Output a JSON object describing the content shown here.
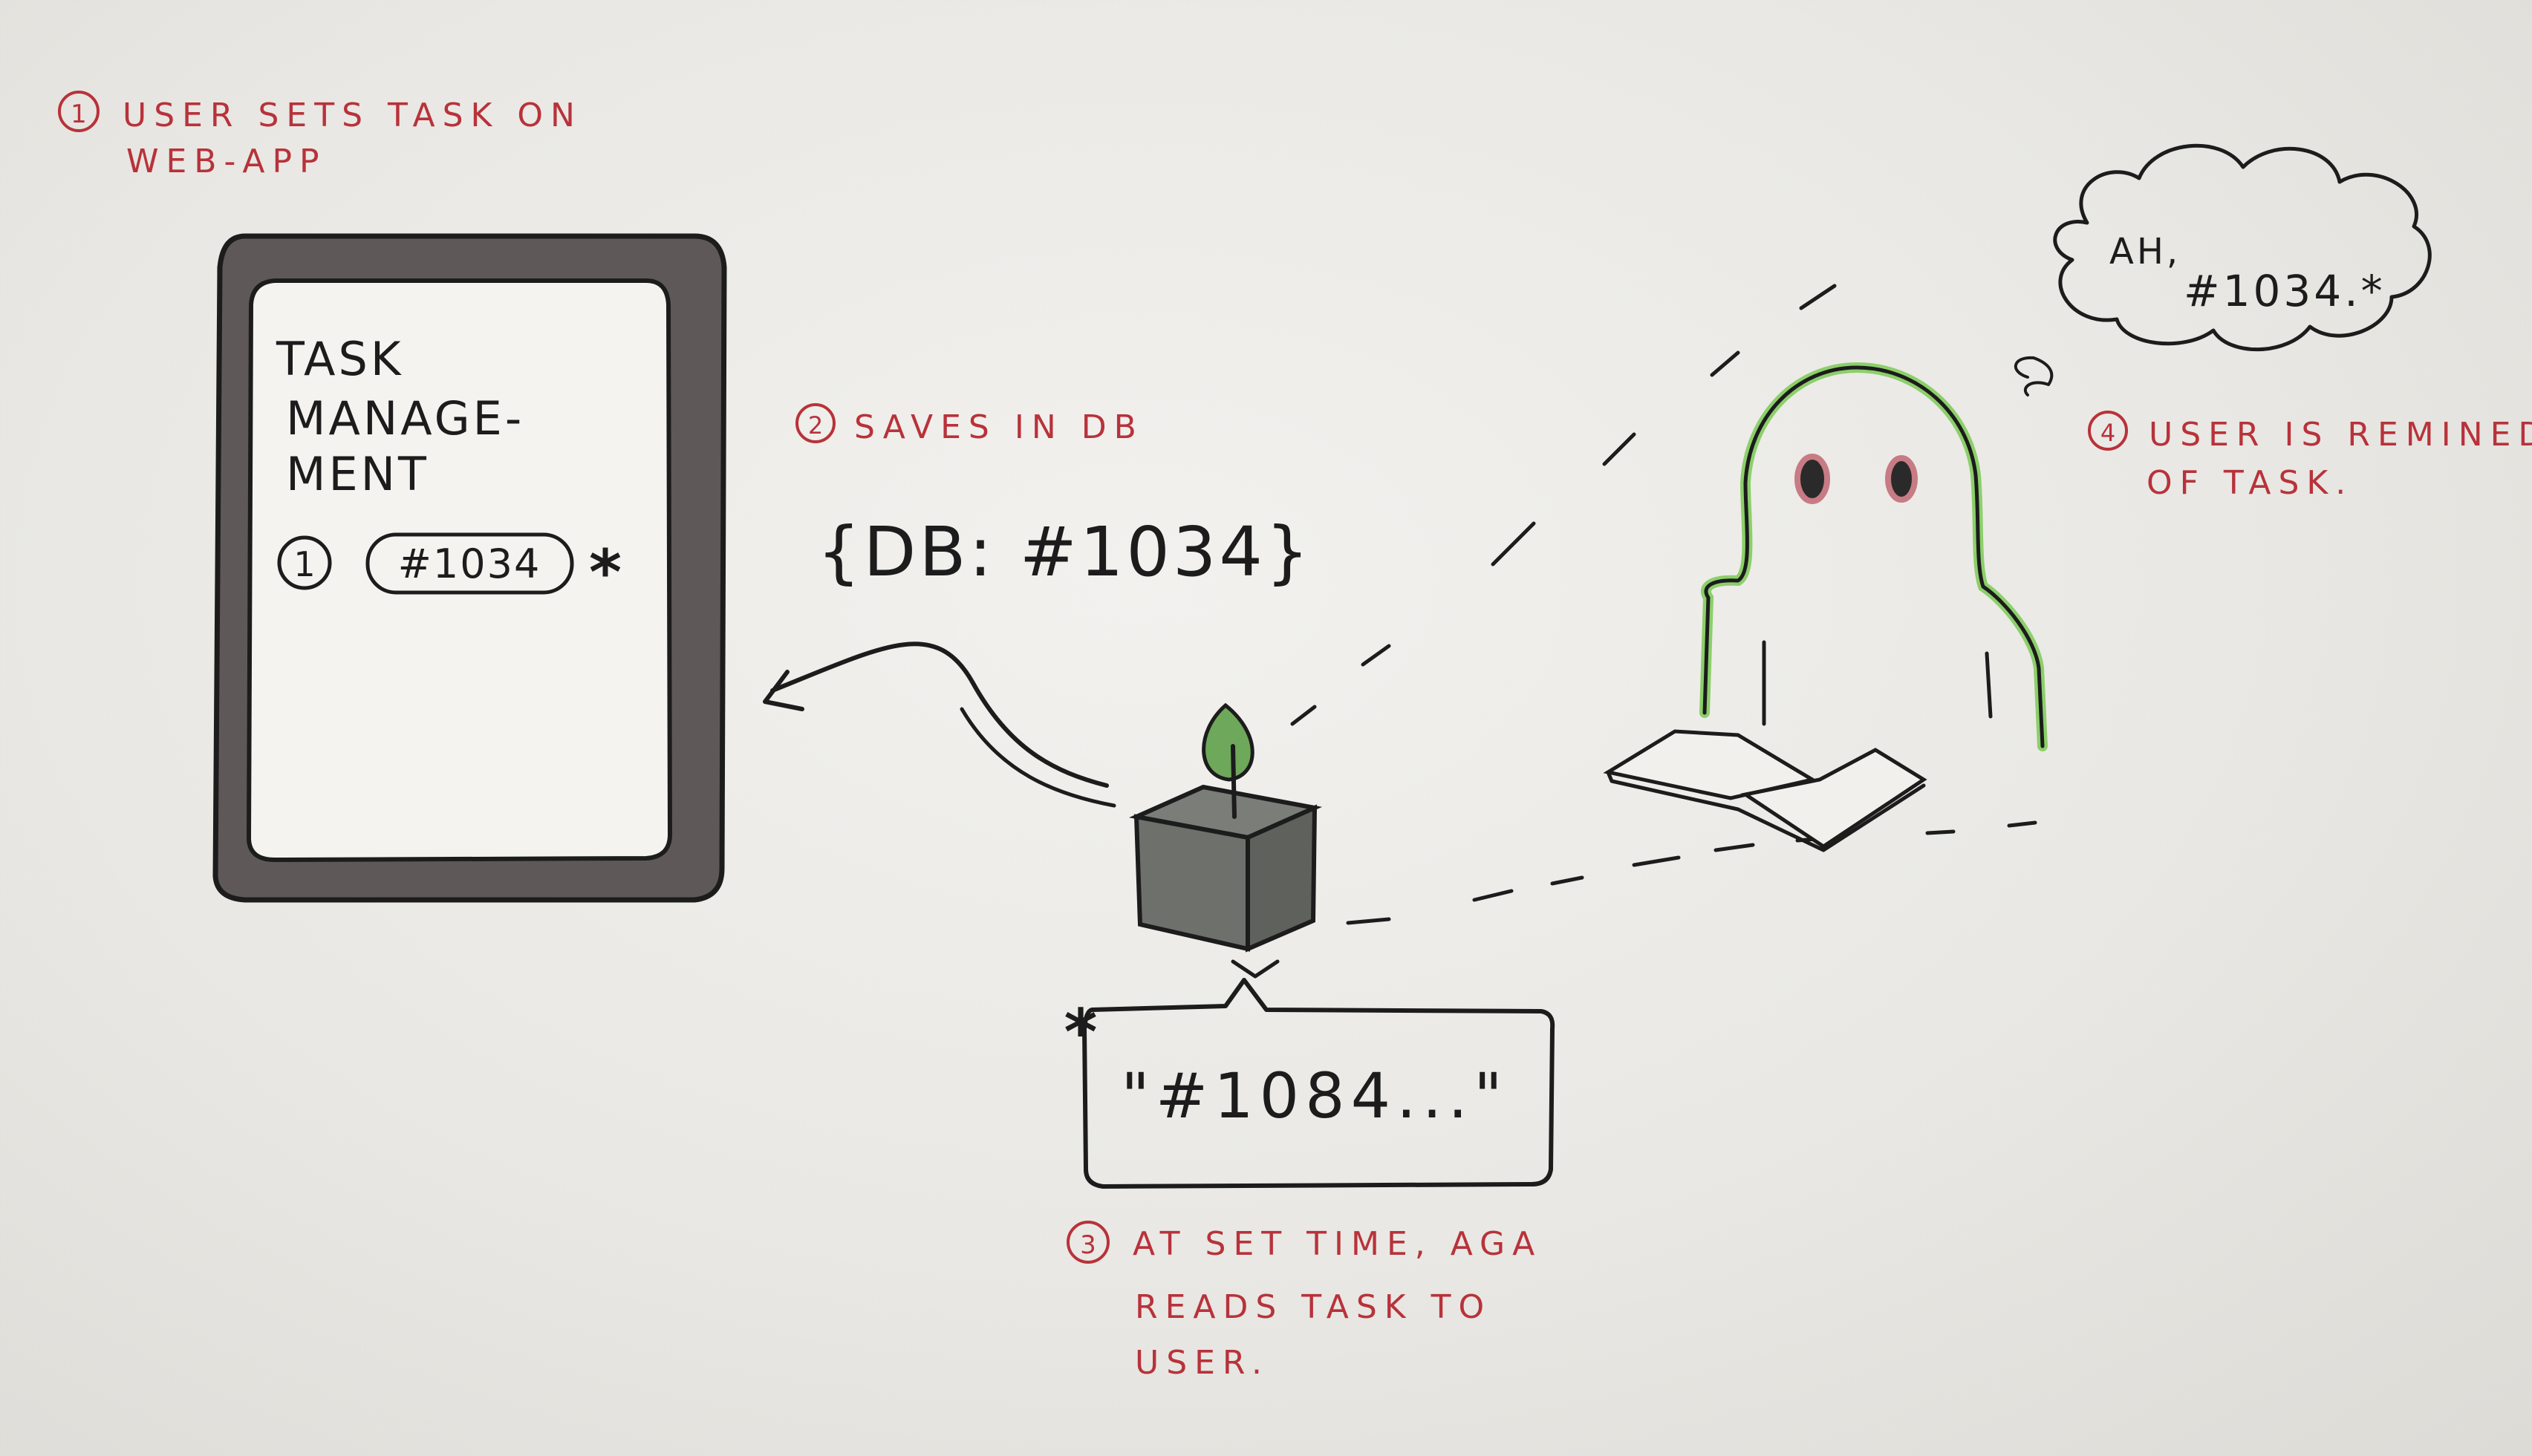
{
  "steps": [
    {
      "number": "1",
      "line1": "USER SETS TASK ON",
      "line2": "WEB-APP",
      "line3": ""
    },
    {
      "number": "2",
      "line1": "SAVES IN DB",
      "line2": "",
      "line3": ""
    },
    {
      "number": "3",
      "line1": "AT SET TIME, AGA",
      "line2": "READS TASK TO",
      "line3": "USER."
    },
    {
      "number": "4",
      "line1": "USER IS REMINED",
      "line2": "OF TASK.",
      "line3": ""
    }
  ],
  "tablet": {
    "title_line1": "TASK",
    "title_line2": "MANAGE-",
    "title_line3": "MENT",
    "item_number": "1",
    "item_label": "#1034",
    "marker": "*"
  },
  "db_label": "{DB: #1034}",
  "speech_text": "\"#1084...\"",
  "speech_marker": "*",
  "thought_line1": "AH,",
  "thought_line2": "#1034.*",
  "colors": {
    "ink": "#1c1c1c",
    "note_red": "#b8323a",
    "frame_gray": "#5f5858",
    "leaf_green": "#6ea85a",
    "outline_green": "#8ccf6a",
    "cube_gray": "#6e706c"
  }
}
